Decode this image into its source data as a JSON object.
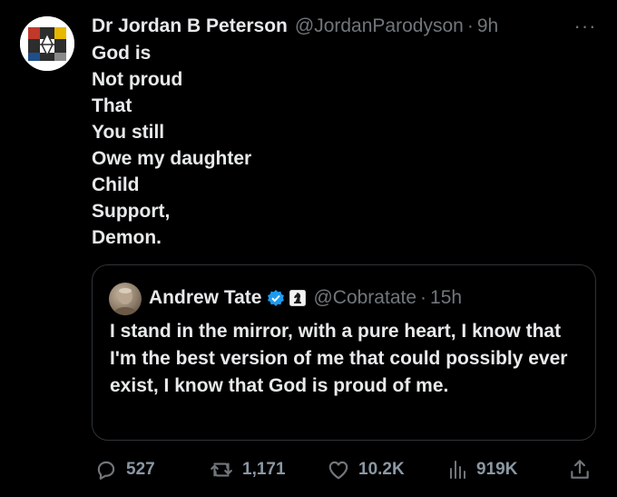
{
  "tweet": {
    "author": {
      "display_name": "Dr Jordan B Peterson",
      "handle": "@JordanParodyson",
      "separator": "·",
      "time": "9h"
    },
    "more_icon": "more-horizontal-icon",
    "more_label": "···",
    "lines": [
      "God is",
      "Not proud",
      "That",
      "You still",
      "Owe my daughter",
      "Child",
      "Support,",
      "Demon."
    ]
  },
  "quote": {
    "author": {
      "display_name": "Andrew Tate",
      "verified_icon": "verified-badge-icon",
      "affiliation_icon": "affiliation-chess-knight-icon",
      "handle": "@Cobratate",
      "separator": "·",
      "time": "15h"
    },
    "text": "I stand in the mirror, with a pure heart, I know that I'm the best version of me that could possibly ever exist, I know that God is proud of me."
  },
  "actions": {
    "reply": {
      "icon": "reply-icon",
      "count": "527"
    },
    "retweet": {
      "icon": "retweet-icon",
      "count": "1,171"
    },
    "like": {
      "icon": "heart-icon",
      "count": "10.2K"
    },
    "views": {
      "icon": "views-bar-chart-icon",
      "count": "919K"
    },
    "share": {
      "icon": "share-icon"
    }
  },
  "colors": {
    "background": "#000000",
    "primary_text": "#e7e9ea",
    "secondary_text": "#71767b",
    "border": "#2f3336",
    "verified_blue": "#1d9bf0"
  }
}
